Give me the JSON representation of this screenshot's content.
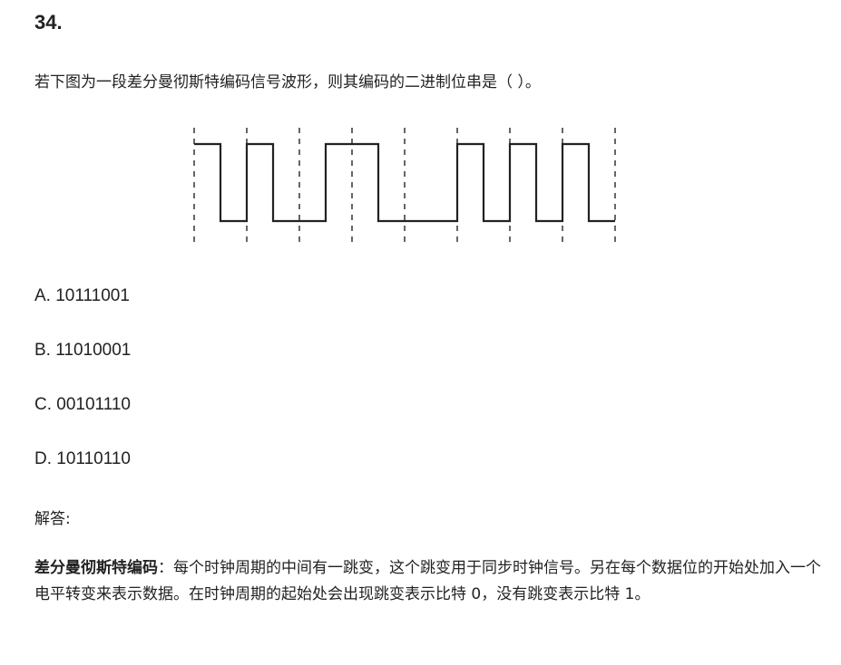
{
  "question": {
    "number": "34.",
    "text": "若下图为一段差分曼彻斯特编码信号波形，则其编码的二进制位串是（ ）。"
  },
  "waveform": {
    "type": "differential-manchester",
    "periods": 8,
    "levels": [
      1,
      0,
      1,
      0,
      0,
      1,
      1,
      0,
      0,
      0,
      1,
      0,
      1,
      0,
      1,
      0
    ],
    "line_color": "#222222",
    "guide_color": "#333333"
  },
  "options": [
    {
      "letter": "A",
      "text": "A. 10111001"
    },
    {
      "letter": "B",
      "text": "B. 11010001"
    },
    {
      "letter": "C",
      "text": "C. 00101110"
    },
    {
      "letter": "D",
      "text": "D. 10110110"
    }
  ],
  "answer": {
    "label": "解答:"
  },
  "explanation": {
    "term": "差分曼彻斯特编码",
    "body": "：每个时钟周期的中间有一跳变，这个跳变用于同步时钟信号。另在每个数据位的开始处加入一个电平转变来表示数据。在时钟周期的起始处会出现跳变表示比特 0，没有跳变表示比特 1。"
  }
}
